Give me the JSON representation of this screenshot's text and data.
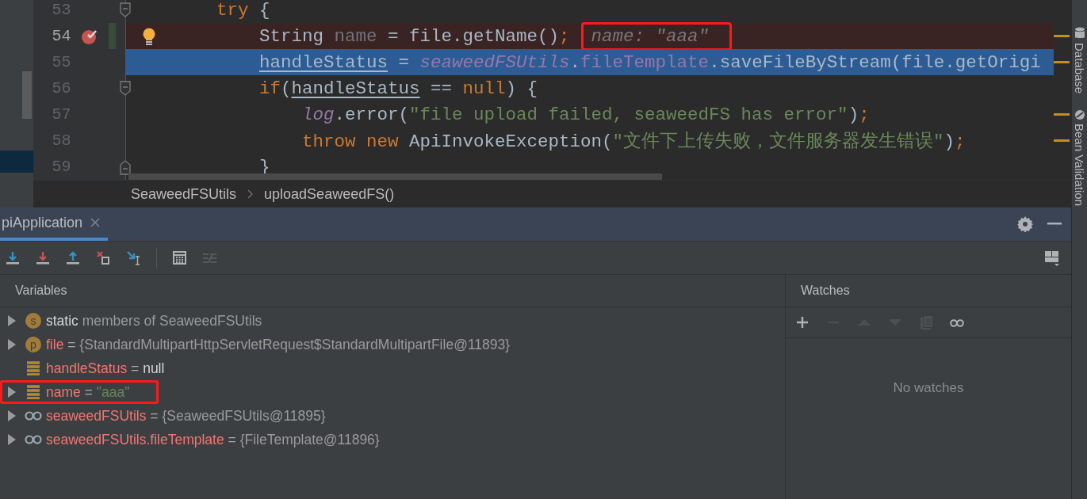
{
  "editor": {
    "lines": [
      {
        "number": "53",
        "breakpoint": false,
        "execution_point": false,
        "fold_start": true,
        "tokens": [
          {
            "kind": "keyword",
            "text": "try"
          },
          {
            "kind": "plain",
            "text": " {"
          }
        ],
        "children": [
          {
            "number": "54",
            "breakpoint": true,
            "execution_point": false,
            "changed": true,
            "bulb": true,
            "stripe_mark": true,
            "tokens": [
              {
                "kind": "plain",
                "text": "String "
              },
              {
                "kind": "unused",
                "text": "name"
              },
              {
                "kind": "plain",
                "text": " = file.getName()"
              },
              {
                "kind": "keyword",
                "text": ";"
              }
            ],
            "inlay": {
              "text": "name: \"aaa\"",
              "outlined": true
            }
          },
          {
            "number": "55",
            "breakpoint": false,
            "execution_point": true,
            "stripe_mark": true,
            "tokens": [
              {
                "kind": "reassigned",
                "text": "handleStatus"
              },
              {
                "kind": "plain",
                "text": " = "
              },
              {
                "kind": "static",
                "text": "seaweedFSUtils"
              },
              {
                "kind": "plain",
                "text": "."
              },
              {
                "kind": "field",
                "text": "fileTemplate"
              },
              {
                "kind": "plain",
                "text": ".saveFileByStream(file.getOrigi"
              }
            ]
          },
          {
            "number": "56",
            "breakpoint": false,
            "execution_point": false,
            "fold_start": true,
            "tokens": [
              {
                "kind": "keyword",
                "text": "if"
              },
              {
                "kind": "plain",
                "text": "("
              },
              {
                "kind": "reassigned",
                "text": "handleStatus"
              },
              {
                "kind": "plain",
                "text": " == "
              },
              {
                "kind": "keyword",
                "text": "null"
              },
              {
                "kind": "plain",
                "text": ") {"
              }
            ],
            "children": [
              {
                "number": "57",
                "breakpoint": false,
                "execution_point": false,
                "stripe_mark": true,
                "tokens": [
                  {
                    "kind": "static",
                    "text": "log"
                  },
                  {
                    "kind": "plain",
                    "text": ".error("
                  },
                  {
                    "kind": "string",
                    "text": "\"file upload failed, seaweedFS has error\""
                  },
                  {
                    "kind": "plain",
                    "text": ")"
                  },
                  {
                    "kind": "keyword",
                    "text": ";"
                  }
                ]
              },
              {
                "number": "58",
                "breakpoint": false,
                "execution_point": false,
                "stripe_mark": true,
                "tokens": [
                  {
                    "kind": "keyword",
                    "text": "throw new"
                  },
                  {
                    "kind": "plain",
                    "text": " ApiInvokeException("
                  },
                  {
                    "kind": "string",
                    "text": "\"文件下上传失败，文件服务器发生错误\""
                  },
                  {
                    "kind": "plain",
                    "text": ")"
                  },
                  {
                    "kind": "keyword",
                    "text": ";"
                  }
                ]
              }
            ]
          },
          {
            "number": "59",
            "breakpoint": false,
            "execution_point": false,
            "fold_end": true,
            "tokens": [
              {
                "kind": "plain",
                "text": "}"
              }
            ]
          }
        ]
      }
    ]
  },
  "breadcrumbs": [
    "SeaweedFSUtils",
    "uploadSeaweedFS()"
  ],
  "side_tools": [
    {
      "label": "Database",
      "kind": "database"
    },
    {
      "label": "Bean Validation",
      "kind": "bean"
    }
  ],
  "debug": {
    "tabs": [
      {
        "label": "piApplication",
        "selected": true
      }
    ],
    "toolbar": [
      {
        "kind": "step-over",
        "disabled": false
      },
      {
        "kind": "step-into",
        "disabled": false
      },
      {
        "kind": "step-out",
        "disabled": false
      },
      {
        "kind": "drop-frame",
        "disabled": false
      },
      {
        "kind": "run-to-cursor",
        "disabled": false
      },
      {
        "kind": "separator"
      },
      {
        "kind": "evaluate",
        "disabled": false
      },
      {
        "kind": "trace",
        "disabled": true
      }
    ],
    "variables": {
      "title": "Variables",
      "rows": [
        {
          "expandable": true,
          "kind": "static",
          "badge": "s",
          "name": "static",
          "value": {
            "kind": "note",
            "text": "members of SeaweedFSUtils"
          },
          "outlined": false
        },
        {
          "expandable": true,
          "kind": "parameter",
          "badge": "p",
          "name": "file",
          "operator": "=",
          "value": {
            "kind": "object",
            "text": "{StandardMultipartHttpServletRequest$StandardMultipartFile@11893}"
          },
          "outlined": false
        },
        {
          "expandable": false,
          "kind": "local",
          "name": "handleStatus",
          "operator": "=",
          "value": {
            "kind": "null",
            "text": "null"
          },
          "outlined": false
        },
        {
          "expandable": true,
          "kind": "local",
          "name": "name",
          "operator": "=",
          "value": {
            "kind": "string",
            "text": "\"aaa\""
          },
          "outlined": true
        },
        {
          "expandable": true,
          "kind": "watch",
          "name": "seaweedFSUtils",
          "operator": "=",
          "value": {
            "kind": "object",
            "text": "{SeaweedFSUtils@11895}"
          },
          "outlined": false
        },
        {
          "expandable": true,
          "kind": "watch",
          "name": "seaweedFSUtils.fileTemplate",
          "operator": "=",
          "value": {
            "kind": "object",
            "text": "{FileTemplate@11896}"
          },
          "outlined": false
        }
      ]
    },
    "watches": {
      "title": "Watches",
      "toolbar": [
        {
          "kind": "add",
          "disabled": false
        },
        {
          "kind": "remove",
          "disabled": true
        },
        {
          "kind": "up",
          "disabled": true
        },
        {
          "kind": "down",
          "disabled": true
        },
        {
          "kind": "copy",
          "disabled": true
        },
        {
          "kind": "glasses",
          "disabled": false
        }
      ],
      "empty_text": "No watches"
    }
  }
}
